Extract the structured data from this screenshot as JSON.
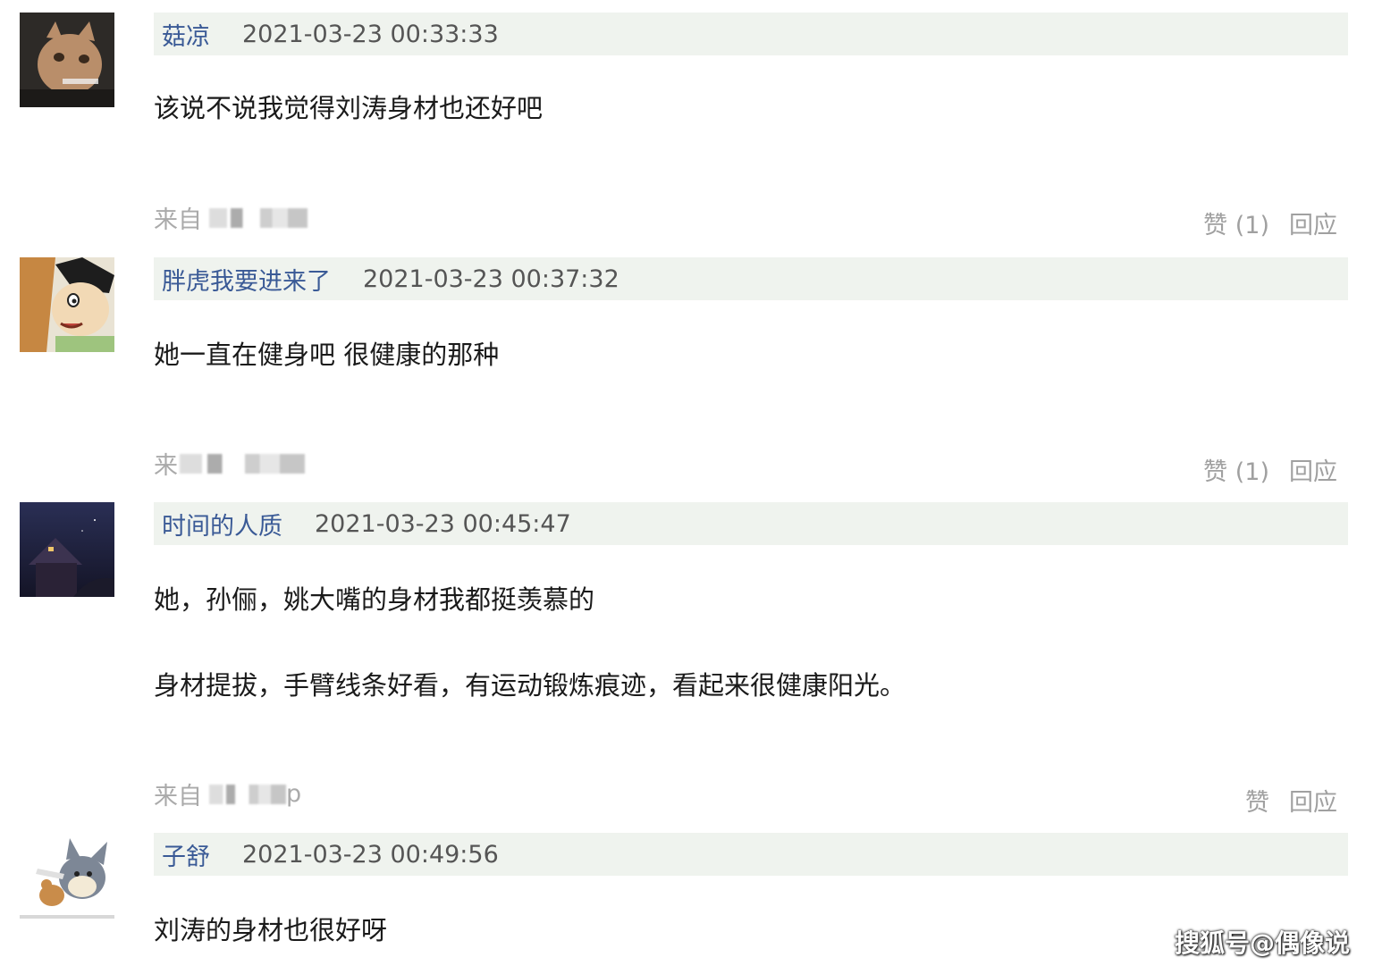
{
  "comments": [
    {
      "author": "菇凉",
      "time": "2021-03-23 00:33:33",
      "lines": [
        "该说不说我觉得刘涛身材也还好吧"
      ],
      "source_prefix": "来自",
      "like_label": "赞 (1)",
      "reply_label": "回应"
    },
    {
      "author": "胖虎我要进来了",
      "time": "2021-03-23 00:37:32",
      "lines": [
        "她一直在健身吧 很健康的那种"
      ],
      "source_prefix": "来",
      "like_label": "赞 (1)",
      "reply_label": "回应"
    },
    {
      "author": "时间的人质",
      "time": "2021-03-23 00:45:47",
      "lines": [
        "她，孙俪，姚大嘴的身材我都挺羡慕的",
        "身材提拔，手臂线条好看，有运动锻炼痕迹，看起来很健康阳光。"
      ],
      "source_prefix": "来自",
      "source_suffix": "p",
      "like_label": "赞",
      "reply_label": "回应"
    },
    {
      "author": "子舒",
      "time": "2021-03-23 00:49:56",
      "lines": [
        "刘涛的身材也很好呀"
      ]
    }
  ],
  "watermark": "搜狐号@偶像说"
}
